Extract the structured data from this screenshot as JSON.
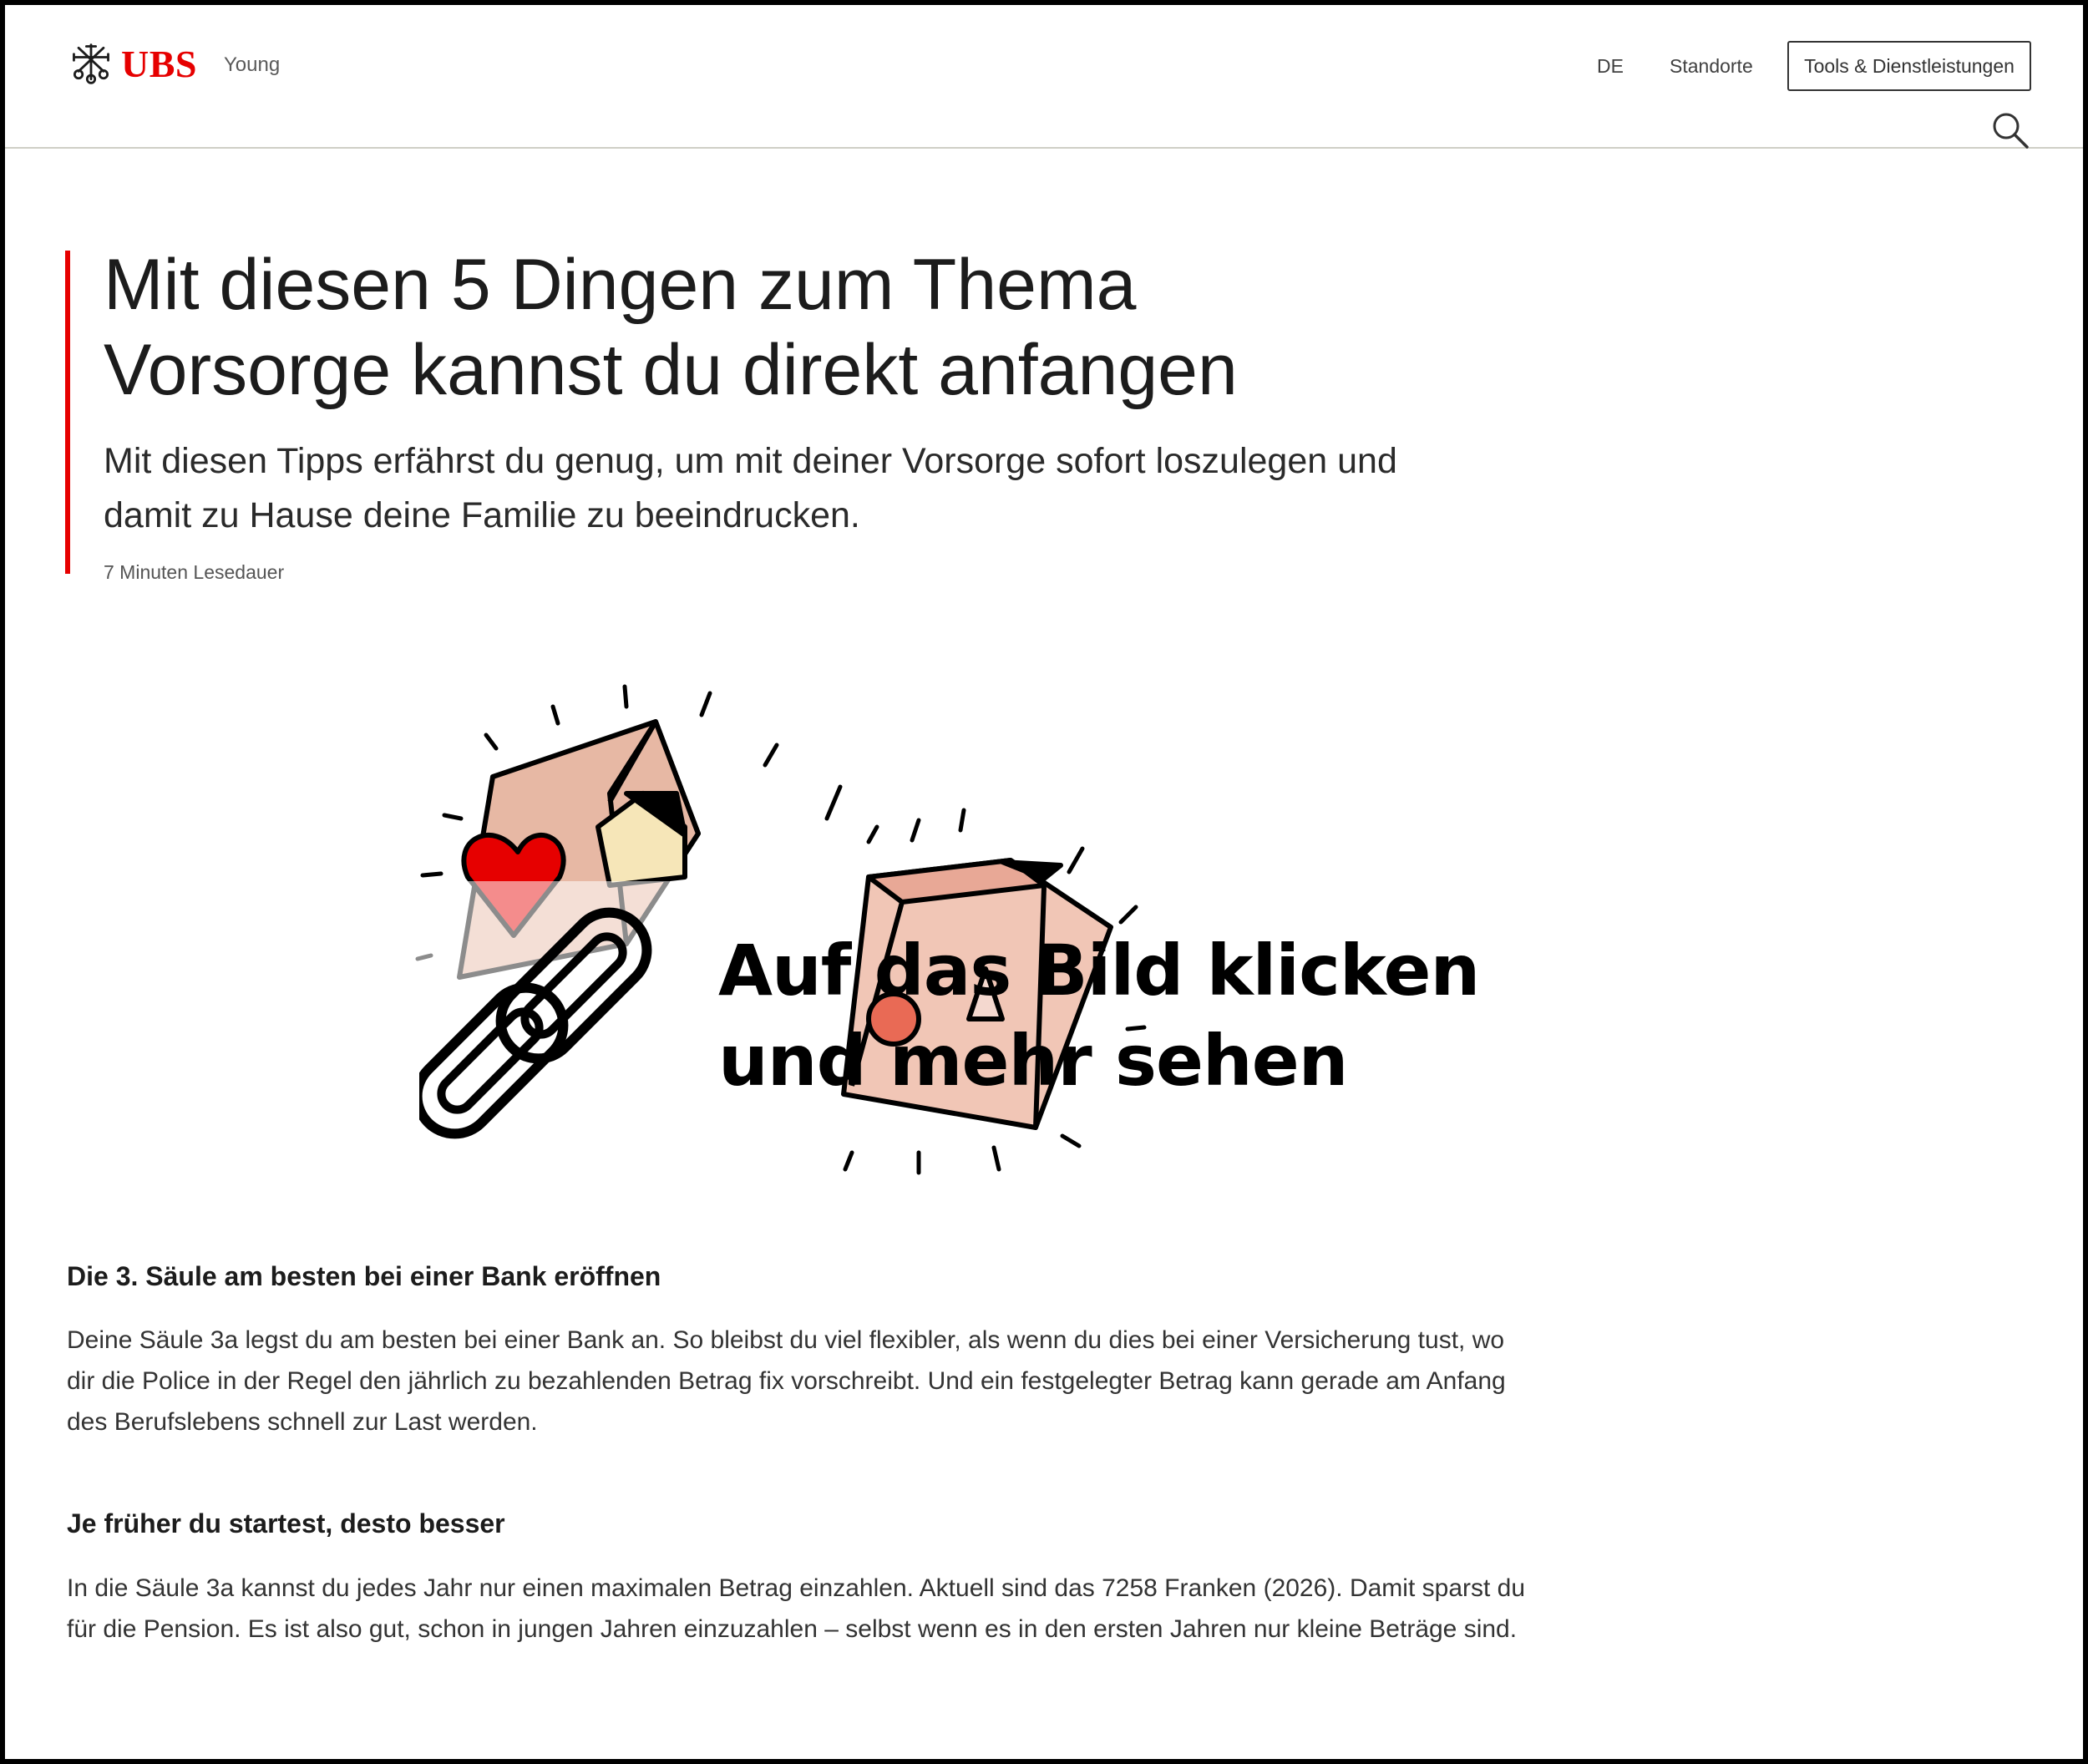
{
  "header": {
    "logo_text": "UBS",
    "brand_sub": "Young",
    "nav_lang": "DE",
    "nav_locations": "Standorte",
    "nav_tools": "Tools & Dienstleistungen",
    "search_icon": "search-icon"
  },
  "hero": {
    "title": "Mit diesen 5 Dingen zum Thema Vorsorge kannst du direkt anfangen",
    "lead": "Mit diesen Tipps erfährst du genug, um mit deiner Vorsorge sofort loszulegen und damit zu Hause deine Familie zu beeindrucken.",
    "read_time": "7 Minuten Lesedauer"
  },
  "image_overlay": {
    "line1": "Auf das Bild klicken",
    "line2": "und mehr sehen",
    "icon": "link-icon"
  },
  "article": {
    "sections": [
      {
        "heading": "Die 3. Säule am besten bei einer Bank eröffnen",
        "body": "Deine Säule 3a legst du am besten bei einer Bank an. So bleibst du viel flexibler, als wenn du dies bei einer Versicherung tust, wo dir die Police in der Regel den jährlich zu bezahlenden Betrag fix vorschreibt. Und ein festgelegter Betrag kann gerade am Anfang des Berufslebens schnell zur Last werden."
      },
      {
        "heading": "Je früher du startest, desto besser",
        "body": "In die Säule 3a kannst du jedes Jahr nur einen maximalen Betrag einzahlen. Aktuell sind das 7258 Franken (2026). Damit sparst du für die Pension. Es ist also gut, schon in jungen Jahren einzuzahlen – selbst wenn es in den ersten Jahren nur kleine Beträge sind."
      }
    ]
  },
  "colors": {
    "brand_red": "#e60000",
    "text": "#1c1c1c",
    "divider": "#cfcfc6"
  }
}
